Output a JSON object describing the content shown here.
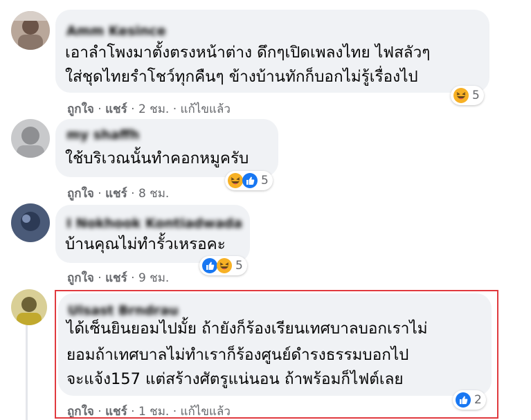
{
  "accent_highlight": "#e0393e",
  "comments": [
    {
      "name": "Amm Kesince",
      "lines": [
        "เอาลำโพงมาตั้งตรงหน้าต่าง ดึกๆเปิดเพลงไทย ไฟสลัวๆ",
        "ใส่ชุดไทยรำโชว์ทุกคืนๆ ข้างบ้านทักก็บอกไม่รู้เรื่องไป"
      ],
      "like": "ถูกใจ",
      "share": "แชร์",
      "time": "2 ชม.",
      "edited": "แก้ไขแล้ว",
      "reaction_icons": [
        "haha-icon"
      ],
      "reaction_count": "5"
    },
    {
      "name": "my shaffh",
      "lines": [
        "ใช้บริเวณนั้นทำคอกหมูครับ"
      ],
      "like": "ถูกใจ",
      "share": "แชร์",
      "time": "8 ชม.",
      "reaction_icons": [
        "haha-icon",
        "like-icon"
      ],
      "reaction_count": "5"
    },
    {
      "name": "I Nokhook Kontiadwada",
      "lines": [
        "บ้านคุณไม่ทำรั้วเหรอคะ"
      ],
      "like": "ถูกใจ",
      "share": "แชร์",
      "time": "9 ชม.",
      "reaction_icons": [
        "like-icon",
        "haha-icon"
      ],
      "reaction_count": "5"
    },
    {
      "name": "Ulsast Brndrau",
      "lines": [
        "ได้เซ็นยินยอมไปมั้ย ถ้ายังก็ร้องเรียนเทศบาลบอกเราไม่",
        "ยอมถ้าเทศบาลไม่ทำเราก็ร้องศูนย์ดำรงธรรมบอกไป",
        "จะแจ้ง157 แต่สร้างศัตรูแน่นอน ถ้าพร้อมก็ไฟต์เลย"
      ],
      "like": "ถูกใจ",
      "share": "แชร์",
      "time": "1 ชม.",
      "edited": "แก้ไขแล้ว",
      "reaction_icons": [
        "like-icon"
      ],
      "reaction_count": "2"
    }
  ]
}
